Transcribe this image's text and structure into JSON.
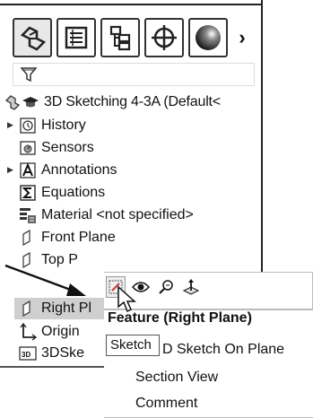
{
  "tabs": [
    {
      "name": "FeatureManager design tree",
      "icon": "feature-manager-icon"
    },
    {
      "name": "PropertyManager",
      "icon": "property-manager-icon"
    },
    {
      "name": "ConfigurationManager",
      "icon": "configuration-manager-icon"
    },
    {
      "name": "DimXpertManager",
      "icon": "dimxpert-icon"
    },
    {
      "name": "DisplayManager",
      "icon": "display-manager-icon"
    }
  ],
  "tabs_more": "›",
  "tree": {
    "root": "3D Sketching 4-3A  (Default<",
    "items": [
      {
        "label": "History",
        "icon": "history-icon",
        "expandable": true
      },
      {
        "label": "Sensors",
        "icon": "sensors-icon",
        "expandable": false
      },
      {
        "label": "Annotations",
        "icon": "annotations-icon",
        "expandable": true
      },
      {
        "label": "Equations",
        "icon": "equations-icon",
        "expandable": false
      },
      {
        "label": "Material <not specified>",
        "icon": "material-icon",
        "expandable": false
      },
      {
        "label": "Front Plane",
        "icon": "plane-icon",
        "expandable": false
      },
      {
        "label": "Top P",
        "icon": "plane-icon",
        "expandable": false
      },
      {
        "label": "Right Pl",
        "icon": "plane-icon",
        "expandable": false,
        "selected": true
      },
      {
        "label": "Origin",
        "icon": "origin-icon",
        "expandable": false
      },
      {
        "label": "3DSke",
        "icon": "3d-sketch-icon",
        "expandable": false
      }
    ]
  },
  "context_toolbar": [
    {
      "name": "sketch",
      "icon": "sketch-grid-icon"
    },
    {
      "name": "hide/show",
      "icon": "eye-icon"
    },
    {
      "name": "zoom to selection",
      "icon": "zoom-icon"
    },
    {
      "name": "normal to",
      "icon": "normal-to-icon"
    }
  ],
  "tooltip": "Sketch",
  "context_menu": {
    "header": "Feature (Right Plane)",
    "items": [
      {
        "label": "3D Sketch On Plane",
        "visible_text": "D Sketch On Plane"
      },
      {
        "label": "Section View",
        "mnemonic_index": 1
      },
      {
        "label": "Comment"
      }
    ]
  },
  "colors": {
    "selection": "#cfcfcf",
    "border": "#333333"
  }
}
